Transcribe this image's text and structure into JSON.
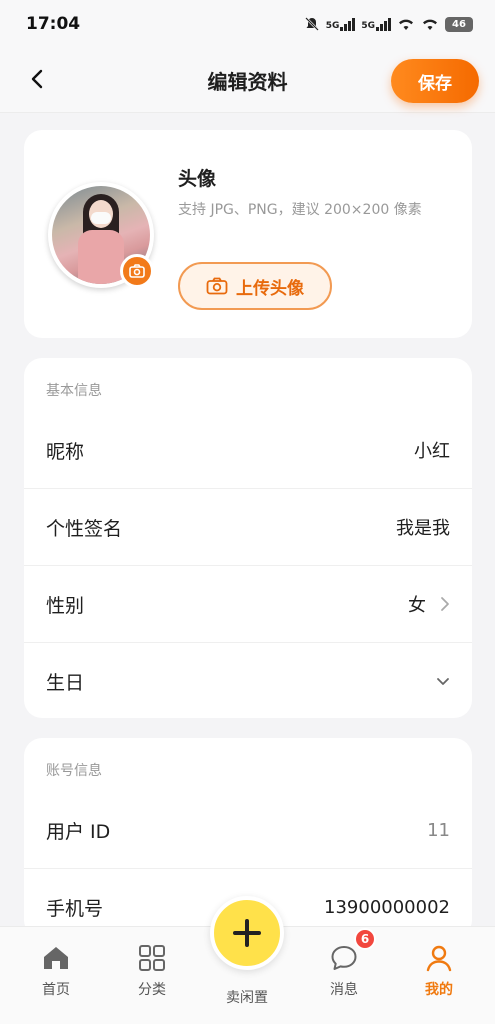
{
  "status": {
    "time": "17:04",
    "net1": "5G",
    "net2": "5G",
    "battery": "46"
  },
  "header": {
    "back_icon": "chevron-left-icon",
    "title": "编辑资料",
    "save_label": "保存"
  },
  "avatar": {
    "title": "头像",
    "hint": "支持 JPG、PNG，建议 200×200 像素",
    "upload_label": "上传头像",
    "camera_icon": "camera-icon"
  },
  "basic": {
    "section_label": "基本信息",
    "rows": [
      {
        "label": "昵称",
        "value": "小红"
      },
      {
        "label": "个性签名",
        "value": "我是我"
      },
      {
        "label": "性别",
        "value": "女"
      },
      {
        "label": "生日",
        "value": ""
      }
    ]
  },
  "account": {
    "section_label": "账号信息",
    "rows": [
      {
        "label": "用户 ID",
        "value": "11"
      },
      {
        "label": "手机号",
        "value": "13900000002"
      }
    ]
  },
  "tabbar": {
    "items": [
      {
        "label": "首页",
        "icon": "home-icon"
      },
      {
        "label": "分类",
        "icon": "grid-icon"
      },
      {
        "label": "卖闲置",
        "icon": "plus-icon"
      },
      {
        "label": "消息",
        "icon": "chat-icon",
        "badge": "6"
      },
      {
        "label": "我的",
        "icon": "user-icon"
      }
    ]
  },
  "colors": {
    "accent": "#f07a10",
    "sell": "#ffe14a",
    "badge": "#f2473e"
  }
}
